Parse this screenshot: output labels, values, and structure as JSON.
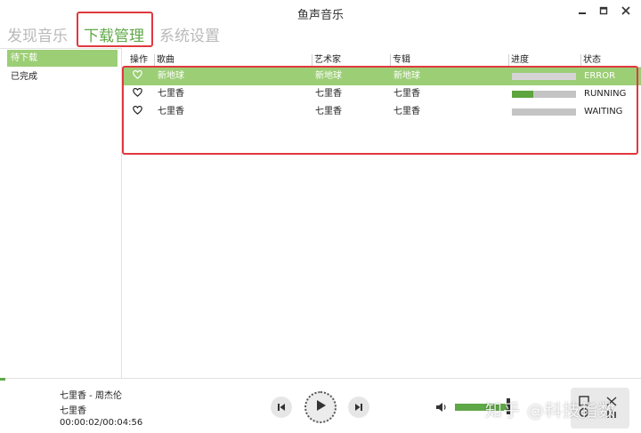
{
  "window": {
    "title": "鱼声音乐",
    "minimize_glyph": "▬",
    "maximize_glyph": "◻",
    "close_glyph": "✕"
  },
  "tabs": [
    {
      "label": "发现音乐",
      "active": false
    },
    {
      "label": "下载管理",
      "active": true
    },
    {
      "label": "系统设置",
      "active": false
    }
  ],
  "sidebar": {
    "items": [
      {
        "label": "待下载",
        "selected": true
      },
      {
        "label": "已完成",
        "selected": false
      }
    ]
  },
  "table": {
    "columns": [
      "操作",
      "歌曲",
      "艺术家",
      "专辑",
      "进度",
      "状态"
    ],
    "rows": [
      {
        "op_icon": "heart-icon",
        "song": "新地球",
        "artist": "新地球",
        "album": "新地球",
        "progress": 0.0,
        "state": "ERROR",
        "selected": true
      },
      {
        "op_icon": "heart-icon",
        "song": "七里香",
        "artist": "七里香",
        "album": "七里香",
        "progress": 0.33,
        "state": "RUNNING",
        "selected": false
      },
      {
        "op_icon": "heart-icon",
        "song": "七里香",
        "artist": "七里香",
        "album": "七里香",
        "progress": 0.0,
        "state": "WAITING",
        "selected": false
      }
    ]
  },
  "player": {
    "title_line": "七里香 - 周杰伦",
    "album_line": "七里香",
    "time": "00:00:02/00:04:56",
    "seek_progress": 0.007,
    "volume": 1.0
  },
  "watermark": "知乎 @科技指数",
  "colors": {
    "accent": "#5fa847",
    "selection": "#9cce76",
    "highlight_box": "#e0383e",
    "inactive_tab": "#b9b9b9"
  }
}
